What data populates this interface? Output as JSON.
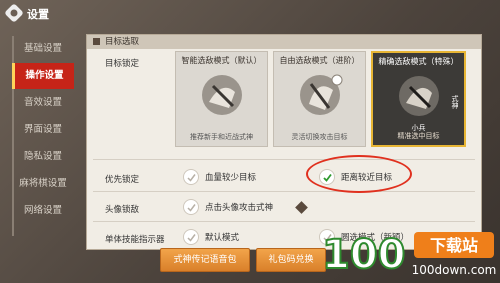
{
  "header": {
    "title": "设置"
  },
  "sidebar": {
    "items": [
      {
        "label": "基础设置"
      },
      {
        "label": "操作设置"
      },
      {
        "label": "音效设置"
      },
      {
        "label": "界面设置"
      },
      {
        "label": "隐私设置"
      },
      {
        "label": "麻将棋设置"
      },
      {
        "label": "网络设置"
      }
    ],
    "active_index": 1
  },
  "main": {
    "section_title": "目标选取",
    "target_lock": {
      "label": "目标锁定",
      "modes": [
        {
          "title": "智能选敌模式（默认）",
          "desc": "推荐新手和近战式神",
          "selected": false
        },
        {
          "title": "自由选敌模式（进阶）",
          "desc": "灵活切换攻击目标",
          "selected": false
        },
        {
          "title": "精确选敌模式（特殊）",
          "desc": "精准选中目标",
          "selected": true,
          "tag_right": "式神",
          "tag_bottom": "小兵"
        }
      ]
    },
    "priority_lock": {
      "label": "优先锁定",
      "options": [
        {
          "label": "血量较少目标"
        },
        {
          "label": "距离较近目标",
          "checked": true
        }
      ]
    },
    "avatar_lock": {
      "label": "头像锁敌",
      "option": "点击头像攻击式神"
    },
    "single_indicator": {
      "label": "单体技能指示器",
      "options": [
        "默认模式",
        "圆选模式（新颖）"
      ]
    }
  },
  "bottom_buttons": [
    {
      "label": "式神传记语音包"
    },
    {
      "label": "礼包码兑换"
    }
  ],
  "watermark": {
    "brand": "下载站",
    "domain": "100down.com",
    "digits": "100"
  },
  "colors": {
    "accent": "#c62418",
    "check_green": "#2e9a2e",
    "button": "#e8913a",
    "highlight": "#e7b534"
  }
}
